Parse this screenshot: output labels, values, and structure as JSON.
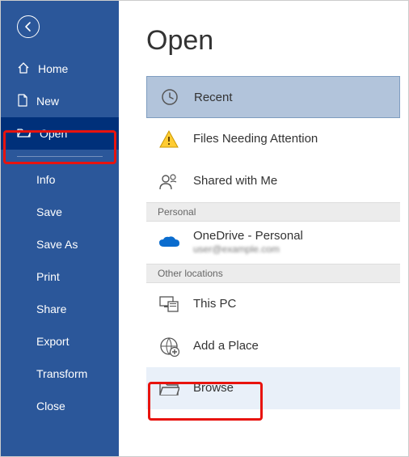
{
  "sidebar": {
    "nav": [
      {
        "label": "Home"
      },
      {
        "label": "New"
      },
      {
        "label": "Open"
      }
    ],
    "sub": [
      {
        "label": "Info"
      },
      {
        "label": "Save"
      },
      {
        "label": "Save As"
      },
      {
        "label": "Print"
      },
      {
        "label": "Share"
      },
      {
        "label": "Export"
      },
      {
        "label": "Transform"
      },
      {
        "label": "Close"
      }
    ]
  },
  "main": {
    "title": "Open",
    "locations": {
      "recent": "Recent",
      "attention": "Files Needing Attention",
      "shared": "Shared with Me",
      "personal_header": "Personal",
      "onedrive": "OneDrive - Personal",
      "onedrive_sub": "user@example.com",
      "other_header": "Other locations",
      "thispc": "This PC",
      "addplace": "Add a Place",
      "browse": "Browse"
    }
  }
}
